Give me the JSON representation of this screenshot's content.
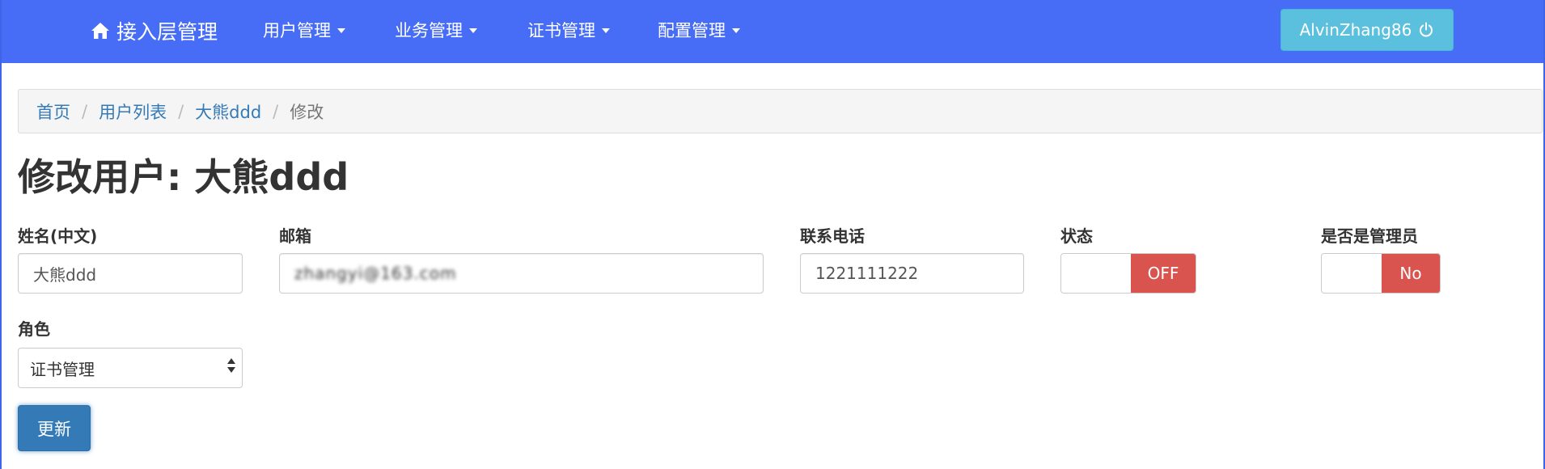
{
  "navbar": {
    "brand": "接入层管理",
    "menu": [
      {
        "label": "用户管理"
      },
      {
        "label": "业务管理"
      },
      {
        "label": "证书管理"
      },
      {
        "label": "配置管理"
      }
    ],
    "user_label": "AlvinZhang86",
    "bg_color": "#476df7"
  },
  "breadcrumb": {
    "items": [
      "首页",
      "用户列表",
      "大熊ddd"
    ],
    "active": "修改"
  },
  "page": {
    "title": "修改用户: 大熊ddd"
  },
  "form": {
    "name_label": "姓名(中文)",
    "name_value": "大熊ddd",
    "email_label": "邮箱",
    "email_value": "zhangyi@163.com",
    "phone_label": "联系电话",
    "phone_value": "1221111222",
    "status_label": "状态",
    "status_value": "OFF",
    "admin_label": "是否是管理员",
    "admin_value": "No",
    "role_label": "角色",
    "role_value": "证书管理",
    "submit_label": "更新"
  }
}
